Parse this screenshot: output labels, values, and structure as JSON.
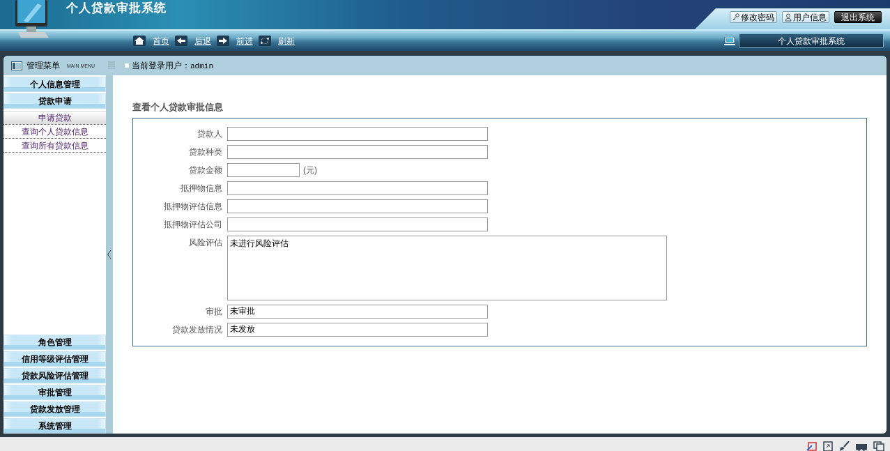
{
  "header": {
    "title": "个人贷款审批系统",
    "top_buttons": [
      {
        "label": "修改密码",
        "kind": "key"
      },
      {
        "label": "用户信息",
        "kind": "user"
      },
      {
        "label": "退出系统",
        "kind": "exit"
      }
    ],
    "nav_links": [
      {
        "label": "首页",
        "kind": "home"
      },
      {
        "label": "后退",
        "kind": "back"
      },
      {
        "label": "前进",
        "kind": "forward"
      },
      {
        "label": "刷新",
        "kind": "refresh"
      }
    ],
    "system_badge": "个人贷款审批系统"
  },
  "sidebar": {
    "title": "管理菜单",
    "subtitle": "MAIN MENU",
    "groups": [
      {
        "label": "个人信息管理"
      },
      {
        "label": "贷款申请",
        "children": [
          {
            "label": "申请贷款",
            "selected": true
          },
          {
            "label": "查询个人贷款信息",
            "selected": false
          },
          {
            "label": "查询所有贷款信息",
            "selected": false
          }
        ]
      },
      {
        "label": "角色管理"
      },
      {
        "label": "信用等级评估管理"
      },
      {
        "label": "贷款风险评估管理"
      },
      {
        "label": "审批管理"
      },
      {
        "label": "贷款发放管理"
      },
      {
        "label": "系统管理"
      }
    ]
  },
  "user_bar": {
    "label": "当前登录用户：",
    "user": "admin"
  },
  "form": {
    "title": "查看个人贷款审批信息",
    "fields": [
      {
        "label": "贷款人",
        "kind": "text"
      },
      {
        "label": "贷款种类",
        "kind": "text"
      },
      {
        "label": "贷款金额",
        "kind": "amount",
        "unit": "(元)"
      },
      {
        "label": "抵押物信息",
        "kind": "text"
      },
      {
        "label": "抵押物评估信息",
        "kind": "text"
      },
      {
        "label": "抵押物评估公司",
        "kind": "text"
      },
      {
        "label": "风险评估",
        "kind": "textarea",
        "value": "未进行风险评估"
      },
      {
        "label": "审批",
        "kind": "text",
        "value": "未审批"
      },
      {
        "label": "贷款发放情况",
        "kind": "text",
        "value": "未发放"
      }
    ]
  }
}
